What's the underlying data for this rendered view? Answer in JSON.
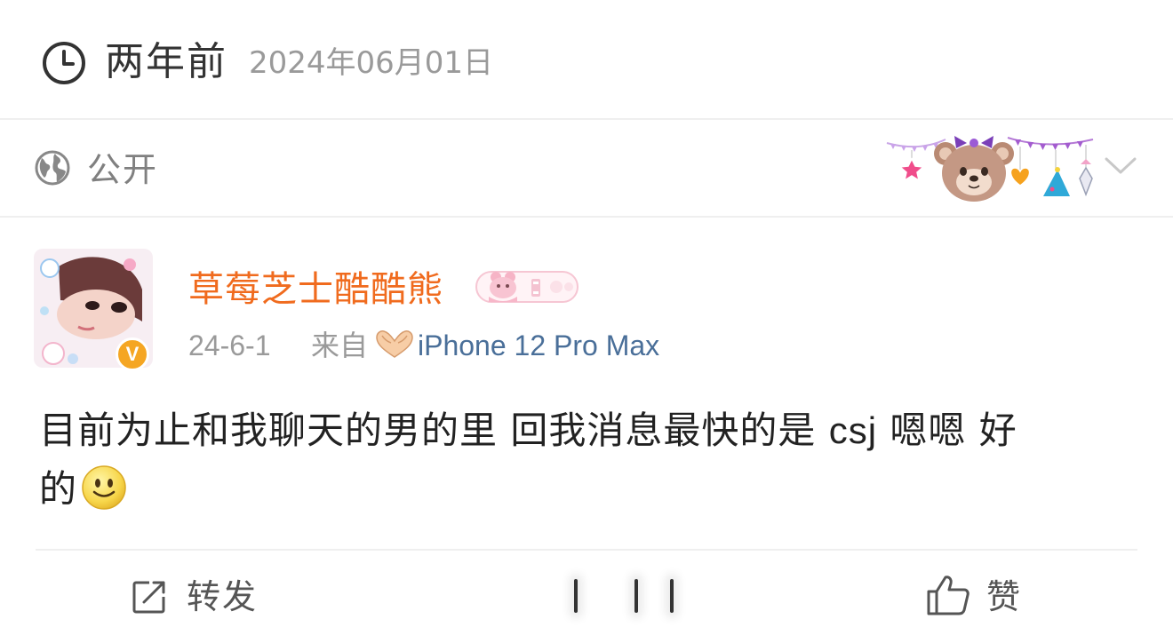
{
  "time": {
    "relative": "两年前",
    "absolute": "2024年06月01日"
  },
  "visibility": {
    "label": "公开"
  },
  "post": {
    "username": "草莓芝士酷酷熊",
    "date": "24-6-1",
    "source_prefix": "来自",
    "source_device": "iPhone 12 Pro Max",
    "body_line1": "目前为止和我聊天的男的里 回我消息最快的是 ",
    "body_latin": "csj",
    "body_line1_end": " 嗯嗯 好",
    "body_line2": "的",
    "verified_badge_text": "V"
  },
  "actions": {
    "repost_label": "转发",
    "like_label": "赞"
  },
  "colors": {
    "username": "#f06b1e",
    "source_device": "#4a6f99",
    "muted": "#9a9a9a",
    "verified": "#f5a623"
  },
  "icons": {
    "clock": "clock-icon",
    "globe": "globe-icon",
    "chevron": "chevron-down-icon",
    "heart_hands": "heart-hands-icon",
    "repost": "repost-icon",
    "like": "thumbs-up-icon",
    "emoji": "smile-emoji-icon"
  }
}
